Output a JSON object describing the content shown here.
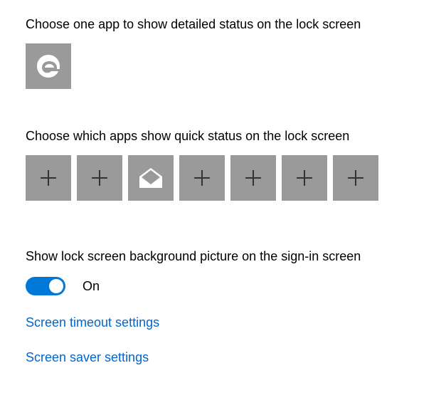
{
  "detailed": {
    "label": "Choose one app to show detailed status on the lock screen",
    "slot": {
      "icon": "edge-icon"
    }
  },
  "quick": {
    "label": "Choose which apps show quick status on the lock screen",
    "slots": [
      {
        "icon": "plus-icon"
      },
      {
        "icon": "plus-icon"
      },
      {
        "icon": "mail-icon"
      },
      {
        "icon": "plus-icon"
      },
      {
        "icon": "plus-icon"
      },
      {
        "icon": "plus-icon"
      },
      {
        "icon": "plus-icon"
      }
    ]
  },
  "signin_bg": {
    "label": "Show lock screen background picture on the sign-in screen",
    "state_label": "On",
    "on": true
  },
  "links": {
    "timeout": "Screen timeout settings",
    "saver": "Screen saver settings"
  },
  "colors": {
    "accent": "#0078d7",
    "tile": "#9a9a9a",
    "link": "#0066cc"
  }
}
